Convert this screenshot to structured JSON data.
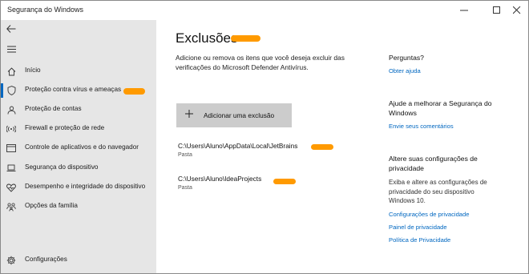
{
  "window": {
    "title": "Segurança do Windows"
  },
  "sidebar": {
    "items": [
      {
        "label": "Início",
        "icon": "home-icon"
      },
      {
        "label": "Proteção contra vírus e ameaças",
        "icon": "shield-icon",
        "active": true
      },
      {
        "label": "Proteção de contas",
        "icon": "person-icon"
      },
      {
        "label": "Firewall e proteção de rede",
        "icon": "antenna-icon"
      },
      {
        "label": "Controle de aplicativos e do navegador",
        "icon": "app-window-icon"
      },
      {
        "label": "Segurança do dispositivo",
        "icon": "laptop-icon"
      },
      {
        "label": "Desempenho e integridade do dispositivo",
        "icon": "heart-icon"
      },
      {
        "label": "Opções da família",
        "icon": "family-icon"
      }
    ],
    "settings_label": "Configurações"
  },
  "main": {
    "title": "Exclusões",
    "description": "Adicione ou remova os itens que você deseja excluir das verificações do Microsoft Defender Antivírus.",
    "add_button_label": "Adicionar uma exclusão",
    "exclusions": [
      {
        "path": "C:\\Users\\Aluno\\AppData\\Local\\JetBrains",
        "type": "Pasta"
      },
      {
        "path": "C:\\Users\\Aluno\\IdeaProjects",
        "type": "Pasta"
      }
    ]
  },
  "aside": {
    "questions_heading": "Perguntas?",
    "help_link": "Obter ajuda",
    "improve_heading": "Ajude a melhorar a Segurança do Windows",
    "feedback_link": "Envie seus comentários",
    "privacy_heading": "Altere suas configurações de privacidade",
    "privacy_text": "Exiba e altere as configurações de privacidade do seu dispositivo Windows 10.",
    "privacy_settings_link": "Configurações de privacidade",
    "privacy_dashboard_link": "Painel de privacidade",
    "privacy_policy_link": "Política de Privacidade"
  },
  "colors": {
    "accent": "#0067c0",
    "redaction": "#ff9a00",
    "sidebar_bg": "#e6e6e6",
    "button_bg": "#cccccc"
  }
}
